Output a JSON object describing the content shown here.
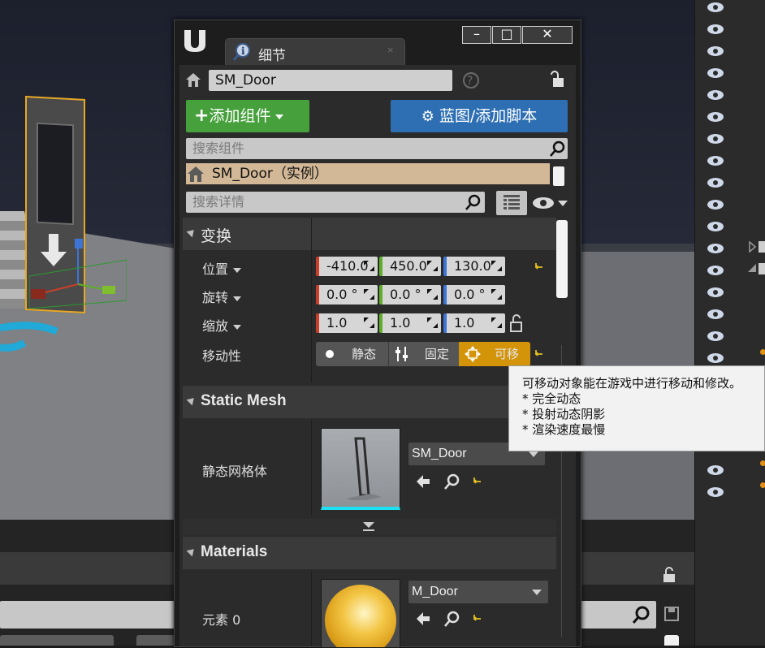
{
  "window": {
    "tab_label": "细节",
    "tab_close": "×",
    "buttons": {
      "minimize": "–",
      "maximize": "□",
      "close": "✕"
    }
  },
  "actor": {
    "name_value": "SM_Door",
    "help_glyph": "?"
  },
  "toolbar": {
    "add_component_label": "添加组件",
    "blueprint_label": "蓝图/添加脚本"
  },
  "components": {
    "search_placeholder": "搜索组件",
    "instance_label": "SM_Door（实例）"
  },
  "details": {
    "search_placeholder": "搜索详情"
  },
  "transform": {
    "section_title": "变换",
    "location": {
      "label": "位置",
      "x": "-410.0",
      "y": "450.0",
      "z": "130.0"
    },
    "rotation": {
      "label": "旋转",
      "x": "0.0 °",
      "y": "0.0 °",
      "z": "0.0 °"
    },
    "scale": {
      "label": "缩放",
      "x": "1.0",
      "y": "1.0",
      "z": "1.0"
    },
    "mobility": {
      "label": "移动性",
      "static": "静态",
      "stationary": "固定",
      "movable": "可移"
    }
  },
  "tooltip": {
    "title": "可移动对象能在游戏中进行移动和修改。",
    "lines": [
      "* 完全动态",
      "* 投射动态阴影",
      "* 渲染速度最慢"
    ]
  },
  "static_mesh": {
    "section_title": "Static Mesh",
    "row_label": "静态网格体",
    "asset_value": "SM_Door"
  },
  "materials": {
    "section_title": "Materials",
    "row_label": "元素 0",
    "asset_value": "M_Door"
  },
  "colors": {
    "add_component_green": "#46a03c",
    "blueprint_blue": "#2e6fb3",
    "instance_row": "#d2b896",
    "movable_selected": "#d4940a",
    "axis_x": "#c8402a",
    "axis_y": "#5fae2c",
    "axis_z": "#3d74d6"
  }
}
